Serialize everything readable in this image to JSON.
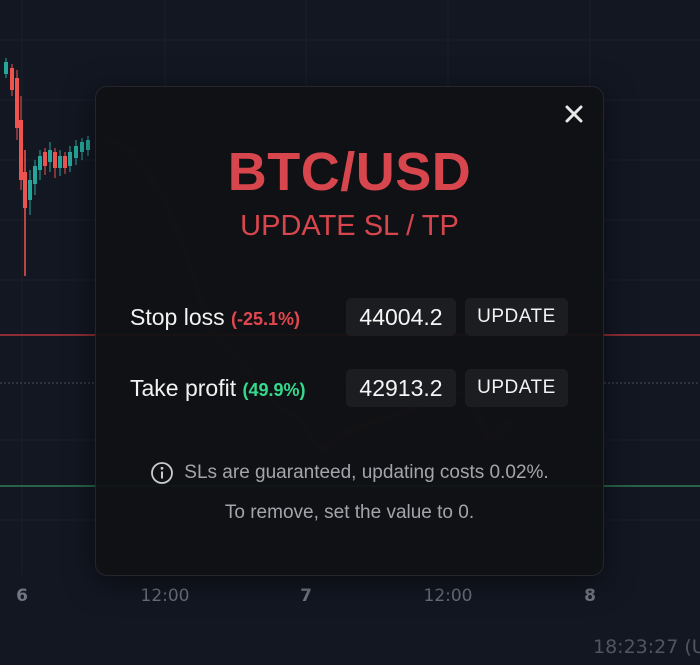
{
  "chart": {
    "x_axis_labels": [
      "6",
      "12:00",
      "7",
      "12:00",
      "8"
    ],
    "clock": "18:23:27 (U",
    "colors": {
      "stop_line": "#b3353b",
      "profit_line": "#2f7d55",
      "up": "#26a69a",
      "down": "#ef5350"
    }
  },
  "modal": {
    "close_icon": "close-icon",
    "pair": "BTC/USD",
    "subtitle": "UPDATE SL / TP",
    "stop_loss": {
      "label": "Stop loss",
      "pct": "(-25.1%)",
      "value": "44004.2",
      "button": "UPDATE"
    },
    "take_profit": {
      "label": "Take profit",
      "pct": "(49.9%)",
      "value": "42913.2",
      "button": "UPDATE"
    },
    "info_icon": "info-icon",
    "info_line1": "SLs are guaranteed, updating costs 0.02%.",
    "info_line2": "To remove, set the value to 0.",
    "colors": {
      "title": "#d8464d",
      "negative": "#e0474f",
      "positive": "#35d98d"
    }
  }
}
